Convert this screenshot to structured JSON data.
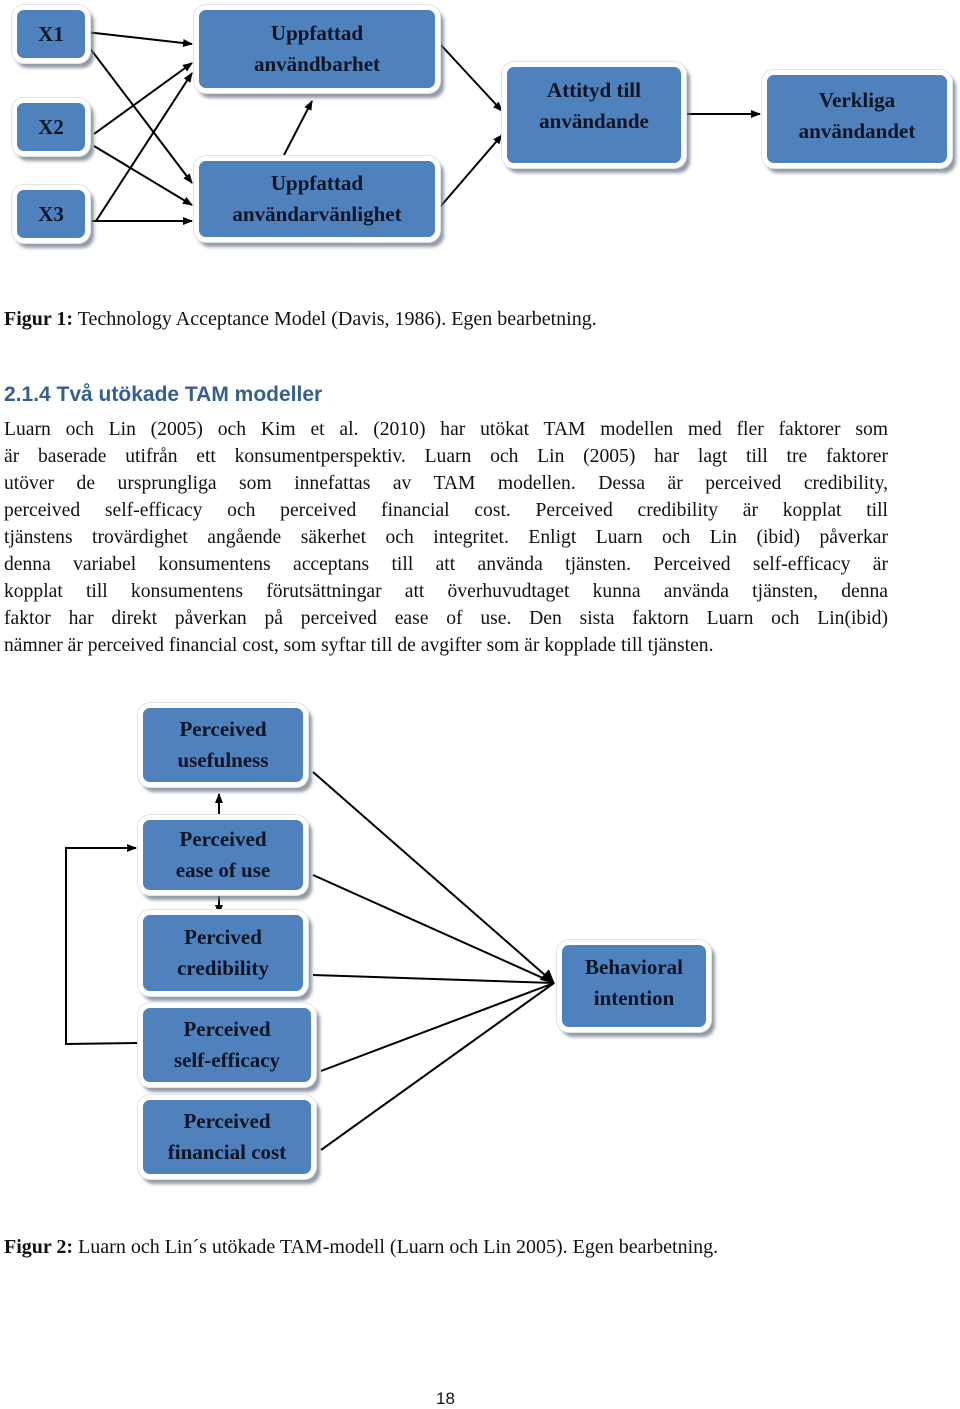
{
  "figure1": {
    "boxes": {
      "x1": "X1",
      "x2": "X2",
      "x3": "X3",
      "perceived_usefulness": [
        "Uppfattad",
        "användbarhet"
      ],
      "perceived_ease": [
        "Uppfattad",
        "användarvänlighet"
      ],
      "attitude": [
        "Attityd till",
        "användande"
      ],
      "actual_use": [
        "Verkliga",
        "användandet"
      ]
    },
    "caption_label": "Figur 1:",
    "caption_text": " Technology Acceptance Model (Davis, 1986). Egen bearbetning."
  },
  "section": {
    "heading": "2.1.4  Två utökade TAM modeller",
    "lines": [
      "Luarn och Lin (2005) och Kim et al. (2010) har utökat TAM modellen med fler faktorer som",
      "är baserade utifrån ett konsumentperspektiv. Luarn och Lin (2005) har lagt till tre faktorer",
      "utöver de ursprungliga som innefattas av TAM modellen. Dessa är perceived credibility,",
      "perceived self-efficacy och perceived financial cost. Perceived credibility är kopplat till",
      "tjänstens trovärdighet angående säkerhet och integritet. Enligt Luarn och Lin (ibid) påverkar",
      "denna variabel konsumentens acceptans till att använda tjänsten. Perceived self-efficacy är",
      "kopplat till konsumentens förutsättningar att överhuvudtaget kunna använda tjänsten, denna",
      "faktor har direkt påverkan på perceived ease of use. Den sista faktorn Luarn och Lin(ibid)",
      "nämner är perceived financial cost, som syftar till de avgifter som är kopplade till tjänsten."
    ]
  },
  "figure2": {
    "boxes": {
      "usefulness": [
        "Perceived",
        "usefulness"
      ],
      "ease": [
        "Perceived",
        "ease of use"
      ],
      "credibility": [
        "Percived",
        "credibility"
      ],
      "self_efficacy": [
        "Perceived",
        "self-efficacy"
      ],
      "financial_cost": [
        "Perceived",
        "financial cost"
      ],
      "behavioral_intention": [
        "Behavioral",
        "intention"
      ]
    },
    "caption_label": "Figur 2:",
    "caption_text": " Luarn och Lin´s utökade TAM-modell (Luarn och Lin 2005). Egen bearbetning."
  },
  "page_number": "18",
  "colors": {
    "box_fill": "#4f81bd",
    "heading": "#365f91"
  }
}
